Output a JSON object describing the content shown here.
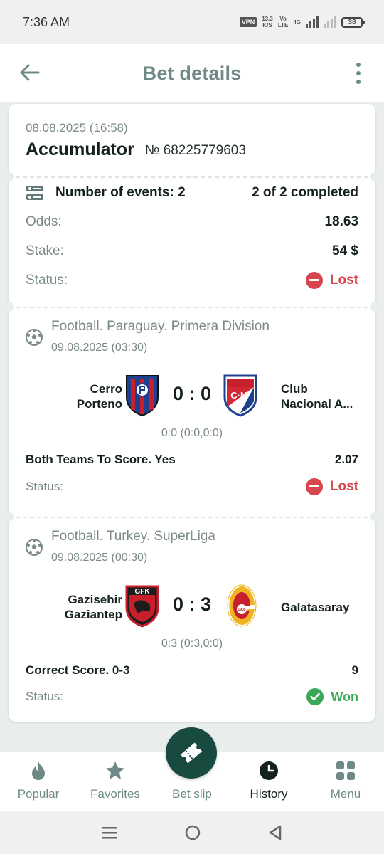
{
  "status_bar": {
    "time": "7:36 AM",
    "vpn": "VPN",
    "speed_value": "13.3",
    "speed_unit": "K/S",
    "volte_top": "Vo",
    "volte_bottom": "LTE",
    "network": "4G",
    "battery": "38"
  },
  "header": {
    "title": "Bet details",
    "back_icon": "arrow-left-icon",
    "menu_icon": "more-vertical-icon"
  },
  "bet": {
    "date": "08.08.2025 (16:58)",
    "type": "Accumulator",
    "number": "№ 68225779603",
    "events_label": "Number of events: 2",
    "completed": "2 of 2 completed",
    "odds_label": "Odds:",
    "odds_value": "18.63",
    "stake_label": "Stake:",
    "stake_value": "54 $",
    "status_label": "Status:",
    "status_value": "Lost"
  },
  "events": [
    {
      "league": "Football. Paraguay. Primera Division",
      "date": "09.08.2025 (03:30)",
      "home_line1": "Cerro",
      "home_line2": "Porteno",
      "away_line1": "Club",
      "away_line2": "Nacional A...",
      "score": "0 : 0",
      "score_detail": "0:0 (0:0,0:0)",
      "market": "Both Teams To Score. Yes",
      "odds": "2.07",
      "status_label": "Status:",
      "status_value": "Lost"
    },
    {
      "league": "Football. Turkey. SuperLiga",
      "date": "09.08.2025 (00:30)",
      "home_line1": "Gazisehir",
      "home_line2": "Gaziantep",
      "home_logo_text": "GFK",
      "away_name": "Galatasaray",
      "away_logo_text": "1905",
      "score": "0 : 3",
      "score_detail": "0:3 (0:3,0:0)",
      "market": "Correct Score. 0-3",
      "odds": "9",
      "status_label": "Status:",
      "status_value": "Won"
    }
  ],
  "bottom_nav": {
    "items": [
      {
        "label": "Popular",
        "icon": "flame-icon"
      },
      {
        "label": "Favorites",
        "icon": "star-icon"
      },
      {
        "label": "Bet slip",
        "icon": "ticket-icon"
      },
      {
        "label": "History",
        "icon": "clock-icon"
      },
      {
        "label": "Menu",
        "icon": "grid-icon"
      }
    ],
    "active": "History"
  },
  "colors": {
    "accent": "#184a40",
    "lost": "#d9454d",
    "won": "#3aa856",
    "muted": "#7b8a88"
  }
}
